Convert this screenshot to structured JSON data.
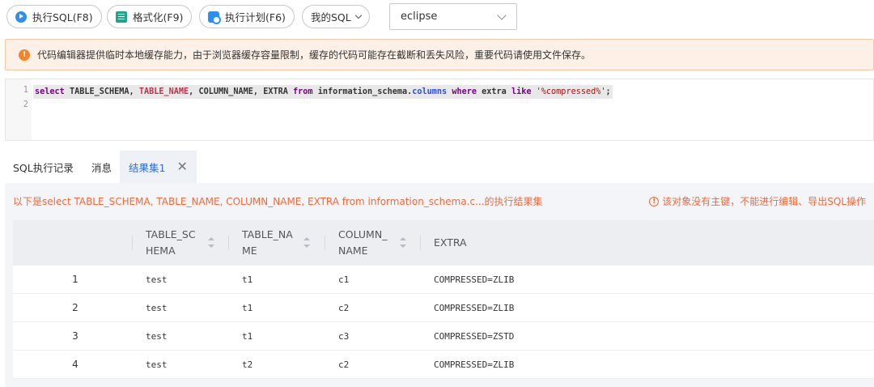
{
  "toolbar": {
    "run_label": "执行SQL(F8)",
    "format_label": "格式化(F9)",
    "plan_label": "执行计划(F6)",
    "my_sql_label": "我的SQL",
    "database_value": "eclipse"
  },
  "notice": {
    "text": "代码编辑器提供临时本地缓存能力，由于浏览器缓存容量限制，缓存的代码可能存在截断和丢失风险，重要代码请使用文件保存。"
  },
  "editor": {
    "line_numbers": [
      "1",
      "2"
    ],
    "tokens": {
      "select": "select",
      "table_schema": "TABLE_SCHEMA,",
      "table_name": "TABLE_NAME",
      "comma1": ",",
      "column_name": "COLUMN_NAME,",
      "extra": "EXTRA",
      "from": "from",
      "schema_ref": "information_schema.",
      "columns": "columns",
      "where": "where",
      "extra_lc": "extra",
      "like": "like",
      "pattern": "'%compressed%'",
      "semicolon": ";"
    }
  },
  "result_tabs": {
    "history": "SQL执行记录",
    "messages": "消息",
    "resultset": "结果集1"
  },
  "result": {
    "summary": "以下是select TABLE_SCHEMA, TABLE_NAME, COLUMN_NAME, EXTRA from information_schema.c...的执行结果集",
    "warning": "该对象没有主键，不能进行编辑、导出SQL操作",
    "columns": [
      {
        "line1": "TABLE_SC",
        "line2": "HEMA"
      },
      {
        "line1": "TABLE_NA",
        "line2": "ME"
      },
      {
        "line1": "COLUMN_",
        "line2": "NAME"
      },
      {
        "line1": "EXTRA",
        "line2": ""
      }
    ],
    "rows": [
      {
        "num": "1",
        "schema": "test",
        "table": "t1",
        "column": "c1",
        "extra": "COMPRESSED=ZLIB"
      },
      {
        "num": "2",
        "schema": "test",
        "table": "t1",
        "column": "c2",
        "extra": "COMPRESSED=ZLIB"
      },
      {
        "num": "3",
        "schema": "test",
        "table": "t1",
        "column": "c3",
        "extra": "COMPRESSED=ZSTD"
      },
      {
        "num": "4",
        "schema": "test",
        "table": "t2",
        "column": "c2",
        "extra": "COMPRESSED=ZLIB"
      }
    ]
  },
  "colors": {
    "accent": "#2f8ff0",
    "warning": "#f26a3a",
    "notice_bg": "#fdf1e7"
  }
}
